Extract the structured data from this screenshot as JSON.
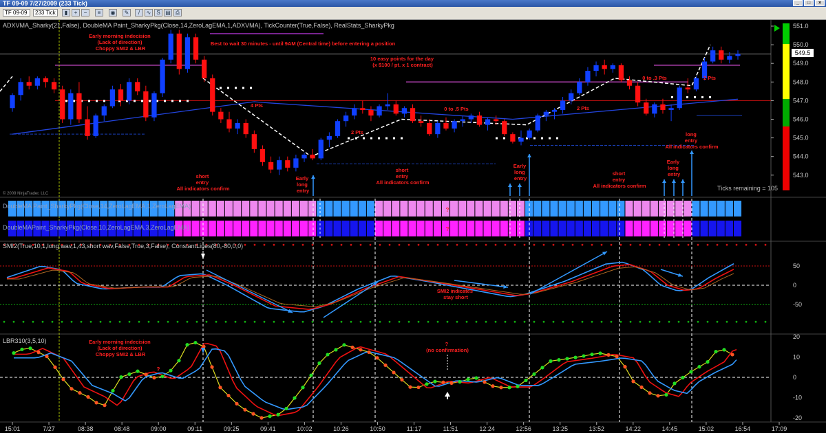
{
  "window": {
    "title": "TF 09-09  7/27/2009 (233 Tick)",
    "buttons": [
      "_",
      "□",
      "×"
    ]
  },
  "toolbar": {
    "instrument": "TF 09-09",
    "period": "233 Tick"
  },
  "main_panel": {
    "indicator_line": "ADXVMA_Sharky(21,False),  DoubleMA  Paint_SharkyPkg(Close,14,ZeroLagEMA,1,ADXVMA),  TickCounter(True,False),  RealStats_SharkyPkg",
    "price_ticks": [
      "551.0",
      "550.0",
      "549.0",
      "548.0",
      "547.0",
      "546.0",
      "545.0",
      "544.0",
      "543.0"
    ],
    "last_price": "549.5",
    "ticks_remaining": "Ticks remaining = 105",
    "copyright": "© 2009 NinjaTrader, LLC"
  },
  "annotations": {
    "early_indecision": [
      "Early morning indecision",
      "(Lack of direction)",
      "Choppy SMI2 & LBR"
    ],
    "wait": "Best to wait 30 minutes - until 9AM (Central time) before entering a position",
    "easy_points": [
      "10 easy points for the day",
      "(x $100 / pt. x 1 contract)"
    ],
    "pts4": "4 Pts",
    "pts2a": "2 Pts",
    "pts_0_5": "0 to .5 Pts",
    "pts2b": "2 Pts",
    "pts_0_3": "0 to .3 Pts",
    "pts2c": "2 Pts",
    "short_entry_1": [
      "short",
      "entry",
      "All indicators confirm"
    ],
    "early_long_1": [
      "Early",
      "long",
      "entry"
    ],
    "short_entry_2": [
      "short",
      "entry",
      "All indicators confirm"
    ],
    "early_long_2": [
      "Early",
      "long",
      "entry"
    ],
    "short_entry_3": [
      "short",
      "entry",
      "All indicators confirm"
    ],
    "early_long_3": [
      "Early",
      "long",
      "entry"
    ],
    "long_entry": [
      "long",
      "entry",
      "All indicators confirm"
    ],
    "smi2_note": [
      "SMI2 indicates",
      "stay short"
    ],
    "lbr_question": "?",
    "no_confirm": [
      "?",
      "(no confirmation)"
    ],
    "paint_q1": "?",
    "paint_q2": "?"
  },
  "paint_panel": {
    "row1_label": "DoubleMA  Paint_SharkyPkg(Close,14,ZeroLagEMA,1,ZeroLagEMA)",
    "row2_label": "DoubleMAPaint_SharkyPkg(Close,10,ZeroLagEMA,3,ZeroLagEMA)"
  },
  "smi_panel": {
    "label": "SMI2(True,10,1,long wav,1,43,short wav,False,True,3,False),  ConstantLines(80,-80,0,0)",
    "ticks": [
      "50",
      "0",
      "-50"
    ]
  },
  "lbr_panel": {
    "label": "LBR310(3,5,10)",
    "ticks": [
      "20",
      "10",
      "0",
      "-10",
      "-20"
    ]
  },
  "time_axis": [
    "15:01",
    "7/27",
    "08:38",
    "08:48",
    "09:00",
    "09:11",
    "09:25",
    "09:41",
    "10:02",
    "10:26",
    "10:50",
    "11:17",
    "11:51",
    "12:24",
    "12:56",
    "13:25",
    "13:52",
    "14:22",
    "14:45",
    "15:02",
    "16:54",
    "17:09"
  ],
  "colors": {
    "up": "#1040ff",
    "down": "#ff1010",
    "pink": "#ee88ee",
    "magenta": "#ff22ff",
    "cyan": "#3399ff",
    "blue": "#1515ee"
  },
  "chart_data": {
    "type": "candlestick",
    "instrument": "TF 09-09",
    "period": "233 Tick",
    "date": "7/27/2009",
    "ylim": [
      542.5,
      551.3
    ],
    "last_price": 549.5,
    "candles": [
      [
        546.6,
        547.4,
        546.4,
        547.3
      ],
      [
        547.3,
        548.2,
        547.0,
        548.0
      ],
      [
        548.0,
        548.3,
        547.6,
        547.8
      ],
      [
        547.8,
        548.3,
        547.6,
        548.2
      ],
      [
        548.2,
        548.3,
        547.7,
        548.0
      ],
      [
        548.0,
        548.2,
        547.4,
        547.6
      ],
      [
        547.6,
        547.8,
        545.8,
        546.0
      ],
      [
        546.0,
        547.6,
        545.7,
        547.4
      ],
      [
        547.4,
        548.0,
        545.8,
        546.0
      ],
      [
        546.0,
        546.7,
        544.9,
        545.1
      ],
      [
        545.1,
        546.3,
        545.0,
        546.2
      ],
      [
        546.2,
        546.8,
        545.9,
        546.7
      ],
      [
        546.7,
        547.8,
        546.6,
        547.6
      ],
      [
        547.6,
        547.9,
        546.7,
        547.0
      ],
      [
        547.0,
        548.2,
        546.8,
        548.0
      ],
      [
        548.0,
        548.2,
        547.3,
        547.5
      ],
      [
        547.5,
        547.8,
        545.9,
        546.1
      ],
      [
        546.1,
        547.5,
        545.9,
        547.4
      ],
      [
        547.4,
        549.3,
        547.2,
        549.2
      ],
      [
        549.2,
        550.8,
        549.0,
        550.6
      ],
      [
        550.6,
        550.8,
        548.4,
        548.7
      ],
      [
        548.7,
        550.6,
        548.5,
        550.4
      ],
      [
        550.4,
        550.6,
        549.0,
        549.2
      ],
      [
        549.2,
        549.4,
        548.0,
        548.2
      ],
      [
        548.2,
        548.4,
        546.2,
        546.4
      ],
      [
        546.4,
        546.6,
        545.8,
        546.0
      ],
      [
        546.0,
        546.4,
        545.3,
        545.5
      ],
      [
        545.5,
        546.0,
        545.2,
        545.8
      ],
      [
        545.8,
        546.0,
        545.0,
        545.2
      ],
      [
        545.2,
        545.4,
        544.2,
        544.4
      ],
      [
        544.4,
        544.6,
        543.5,
        543.7
      ],
      [
        543.7,
        544.0,
        543.1,
        543.3
      ],
      [
        543.3,
        544.0,
        543.0,
        543.8
      ],
      [
        543.8,
        544.0,
        543.2,
        543.4
      ],
      [
        543.4,
        544.1,
        543.2,
        543.9
      ],
      [
        543.9,
        544.2,
        543.7,
        544.1
      ],
      [
        544.1,
        544.4,
        543.8,
        543.9
      ],
      [
        543.9,
        545.0,
        543.8,
        544.9
      ],
      [
        544.9,
        545.3,
        544.5,
        545.1
      ],
      [
        545.1,
        546.0,
        545.0,
        545.9
      ],
      [
        545.9,
        546.4,
        545.6,
        546.2
      ],
      [
        546.2,
        546.8,
        546.0,
        546.6
      ],
      [
        546.6,
        547.0,
        546.3,
        546.5
      ],
      [
        546.5,
        546.7,
        545.9,
        546.2
      ],
      [
        546.2,
        546.8,
        546.1,
        546.7
      ],
      [
        546.7,
        547.4,
        546.5,
        546.8
      ],
      [
        546.8,
        547.0,
        546.2,
        546.3
      ],
      [
        546.3,
        546.7,
        546.1,
        546.6
      ],
      [
        546.6,
        546.8,
        545.8,
        545.9
      ],
      [
        545.9,
        546.2,
        545.6,
        545.8
      ],
      [
        545.8,
        546.0,
        545.1,
        545.2
      ],
      [
        545.2,
        545.9,
        545.0,
        545.8
      ],
      [
        545.8,
        546.1,
        545.4,
        545.5
      ],
      [
        545.5,
        546.0,
        545.3,
        545.9
      ],
      [
        545.9,
        546.2,
        545.6,
        546.0
      ],
      [
        546.0,
        546.3,
        545.8,
        546.2
      ],
      [
        546.2,
        546.4,
        545.6,
        545.7
      ],
      [
        545.7,
        546.1,
        545.4,
        546.0
      ],
      [
        546.0,
        546.2,
        545.7,
        545.9
      ],
      [
        545.9,
        546.0,
        545.1,
        545.2
      ],
      [
        545.2,
        545.3,
        544.7,
        544.8
      ],
      [
        544.8,
        545.4,
        544.6,
        545.0
      ],
      [
        545.0,
        545.5,
        544.9,
        545.4
      ],
      [
        545.4,
        546.3,
        545.3,
        546.2
      ],
      [
        546.2,
        546.5,
        545.9,
        546.4
      ],
      [
        546.4,
        546.6,
        546.0,
        546.5
      ],
      [
        546.5,
        547.2,
        546.3,
        547.0
      ],
      [
        547.0,
        547.6,
        546.8,
        547.4
      ],
      [
        547.4,
        548.2,
        547.3,
        548.0
      ],
      [
        548.0,
        548.8,
        547.8,
        548.6
      ],
      [
        548.6,
        549.1,
        548.3,
        548.9
      ],
      [
        548.9,
        549.2,
        548.4,
        548.7
      ],
      [
        548.7,
        549.0,
        548.5,
        548.9
      ],
      [
        548.9,
        549.0,
        548.0,
        548.1
      ],
      [
        548.1,
        548.3,
        547.6,
        547.8
      ],
      [
        547.8,
        548.0,
        546.7,
        546.9
      ],
      [
        546.9,
        547.1,
        546.2,
        546.3
      ],
      [
        546.3,
        546.9,
        546.1,
        546.8
      ],
      [
        546.8,
        547.1,
        546.3,
        546.5
      ],
      [
        546.5,
        546.8,
        545.9,
        546.6
      ],
      [
        546.6,
        547.8,
        546.5,
        547.7
      ],
      [
        547.7,
        548.2,
        547.4,
        547.6
      ],
      [
        547.6,
        548.3,
        547.5,
        548.2
      ],
      [
        548.2,
        549.3,
        548.1,
        549.1
      ],
      [
        549.1,
        549.9,
        549.0,
        549.7
      ],
      [
        549.7,
        549.9,
        549.0,
        549.2
      ],
      [
        549.2,
        549.6,
        549.0,
        549.4
      ],
      [
        549.4,
        549.7,
        549.2,
        549.5
      ]
    ]
  }
}
